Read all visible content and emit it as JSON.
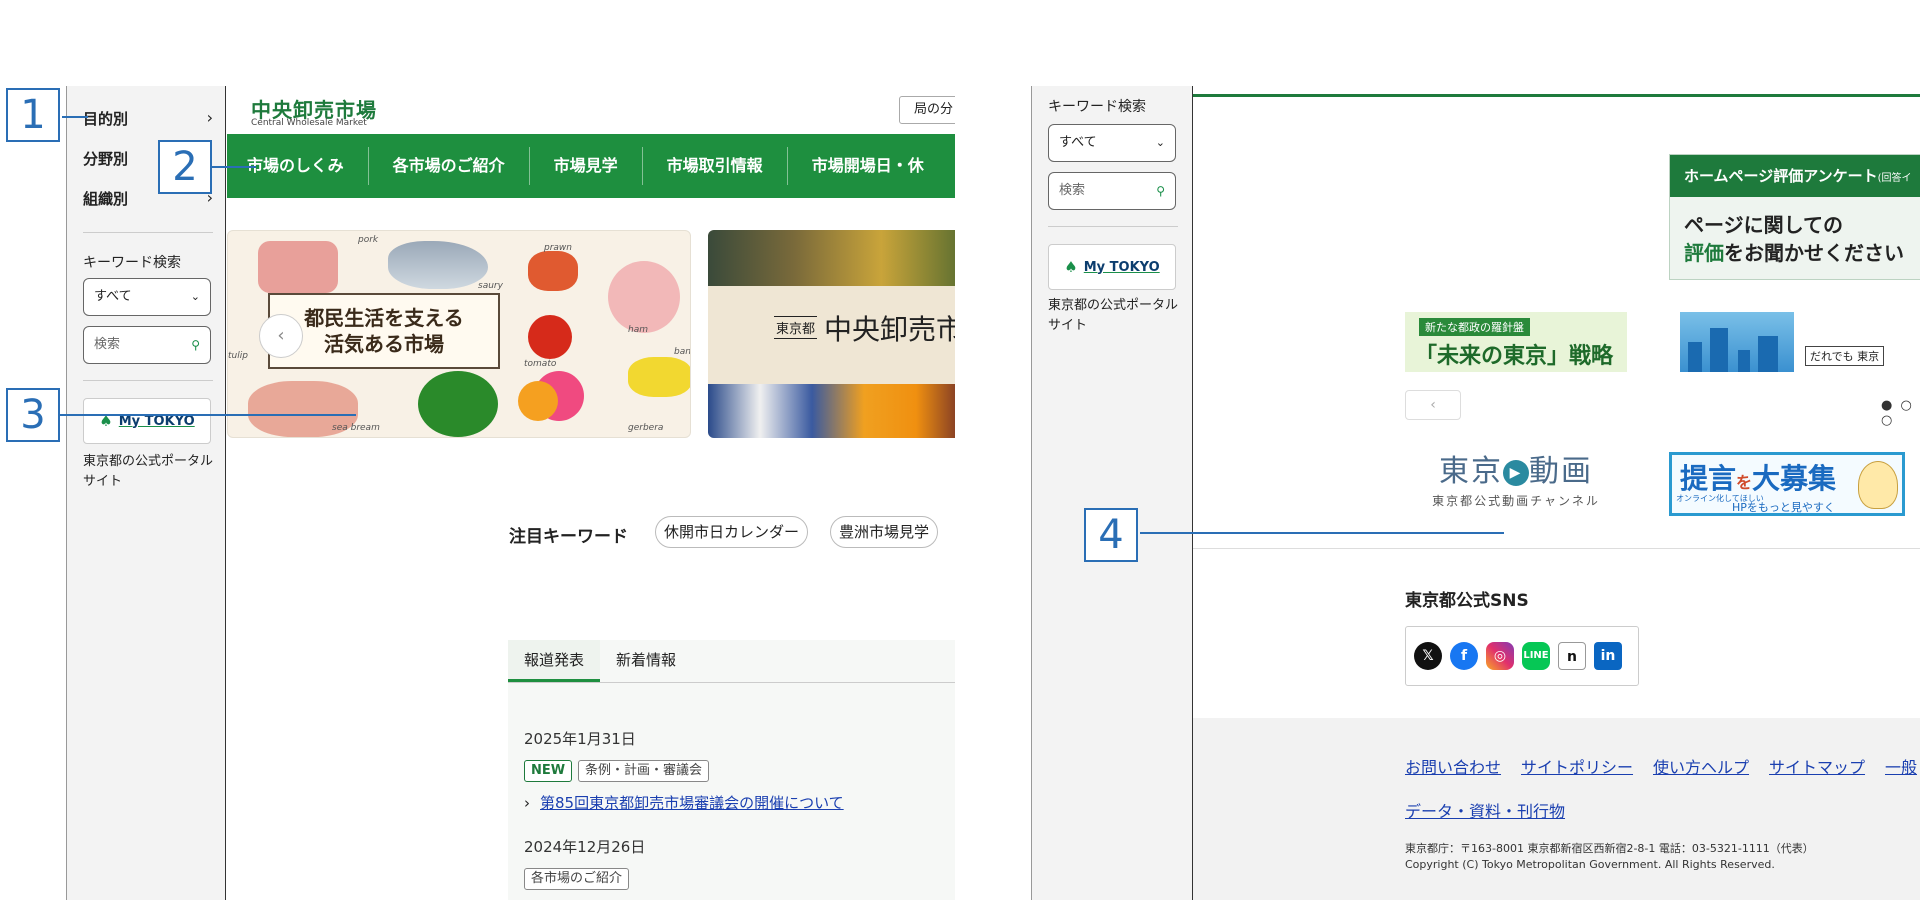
{
  "left_sidebar": {
    "nav": [
      {
        "label": "目的別"
      },
      {
        "label": "分野別"
      },
      {
        "label": "組織別"
      }
    ],
    "keyword_label": "キーワード検索",
    "scope_select": "すべて",
    "search_placeholder": "検索",
    "mytokyo_label": "My TOKYO",
    "portal_text": "東京都の公式ポータルサイト"
  },
  "left_main": {
    "logo_ja": "中央卸売市場",
    "logo_en": "Central Wholesale Market",
    "lang_button": "局の分",
    "nav": [
      {
        "label": "市場のしくみ"
      },
      {
        "label": "各市場のご紹介"
      },
      {
        "label": "市場見学"
      },
      {
        "label": "市場取引情報"
      },
      {
        "label": "市場開場日・休"
      }
    ],
    "hero1": {
      "line1": "都民生活を支える",
      "line2": "活気ある市場",
      "labels": [
        "pork",
        "saury",
        "prawn",
        "tomato",
        "ham",
        "banana",
        "tulip",
        "sea bream",
        "gerbera"
      ]
    },
    "hero2": {
      "tag": "東京都",
      "title": "中央卸売市"
    },
    "keywords": {
      "label": "注目キーワード",
      "chips": [
        "休開市日カレンダー",
        "豊洲市場見学"
      ]
    },
    "tabs": [
      {
        "label": "報道発表"
      },
      {
        "label": "新着情報"
      }
    ],
    "news": [
      {
        "date": "2025年1月31日",
        "badges": [
          "NEW",
          "条例・計画・審議会"
        ],
        "link": "第85回東京都卸売市場審議会の開催について"
      },
      {
        "date": "2024年12月26日",
        "badges": [
          "各市場のご紹介"
        ]
      }
    ]
  },
  "right_sidebar": {
    "keyword_label": "キーワード検索",
    "scope_select": "すべて",
    "search_placeholder": "検索",
    "mytokyo_label": "My TOKYO",
    "portal_text": "東京都の公式ポータルサイト"
  },
  "right_main": {
    "survey": {
      "header": "ホームページ評価アンケート",
      "header_small": "(回答イ",
      "line1": "ページに関しての",
      "line2_green": "評価",
      "line2_rest": "をお聞かせください"
    },
    "banners": {
      "mirai_top": "新たな都政の羅針盤",
      "mirai_main": "「未来の東京」戦略",
      "daredemo": "だれでも 東京",
      "douga_main_a": "東京",
      "douga_main_b": "動画",
      "douga_sub": "東京都公式動画チャンネル",
      "teigen_a": "提言",
      "teigen_wo": "を",
      "teigen_b": "大募集",
      "teigen_s1": "オンライン化してほしい",
      "teigen_s2": "HPをもっと見やすく"
    },
    "carousel_dots": "● ○ ○",
    "sns_title": "東京都公式SNS",
    "sns": [
      "x-icon",
      "facebook-icon",
      "instagram-icon",
      "line-icon",
      "note-icon",
      "linkedin-icon"
    ],
    "footer_links": [
      "お問い合わせ",
      "サイトポリシー",
      "使い方ヘルプ",
      "サイトマップ",
      "一般"
    ],
    "footer_link2": "データ・資料・刊行物",
    "address": "東京都庁：〒163-8001 東京都新宿区西新宿2-8-1 電話：03-5321-1111（代表）",
    "copyright": "Copyright (C) Tokyo Metropolitan Government. All Rights Reserved."
  },
  "callouts": [
    "1",
    "2",
    "3",
    "4"
  ],
  "colors": {
    "brand_green": "#1e8f3f",
    "callout_blue": "#2a6eb5",
    "link_blue": "#1a3fb0"
  }
}
